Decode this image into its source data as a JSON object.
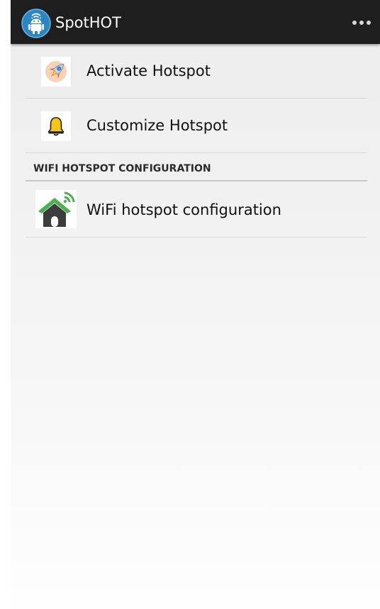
{
  "app": {
    "title": "SpotHOT",
    "icon": "android-hotspot-app-icon",
    "overflow_icon": "overflow-menu-icon"
  },
  "items": [
    {
      "label": "Activate Hotspot",
      "icon": "rocket-icon"
    },
    {
      "label": "Customize Hotspot",
      "icon": "bell-icon"
    }
  ],
  "category": {
    "title": "WIFI HOTSPOT CONFIGURATION",
    "items": [
      {
        "label": "WiFi hotspot configuration",
        "icon": "wifi-home-icon"
      }
    ]
  },
  "colors": {
    "actionbar": "#1e1e1e",
    "app_icon_blue": "#2e86c1",
    "bell_yellow": "#f5c518",
    "house_green": "#4caf50"
  }
}
